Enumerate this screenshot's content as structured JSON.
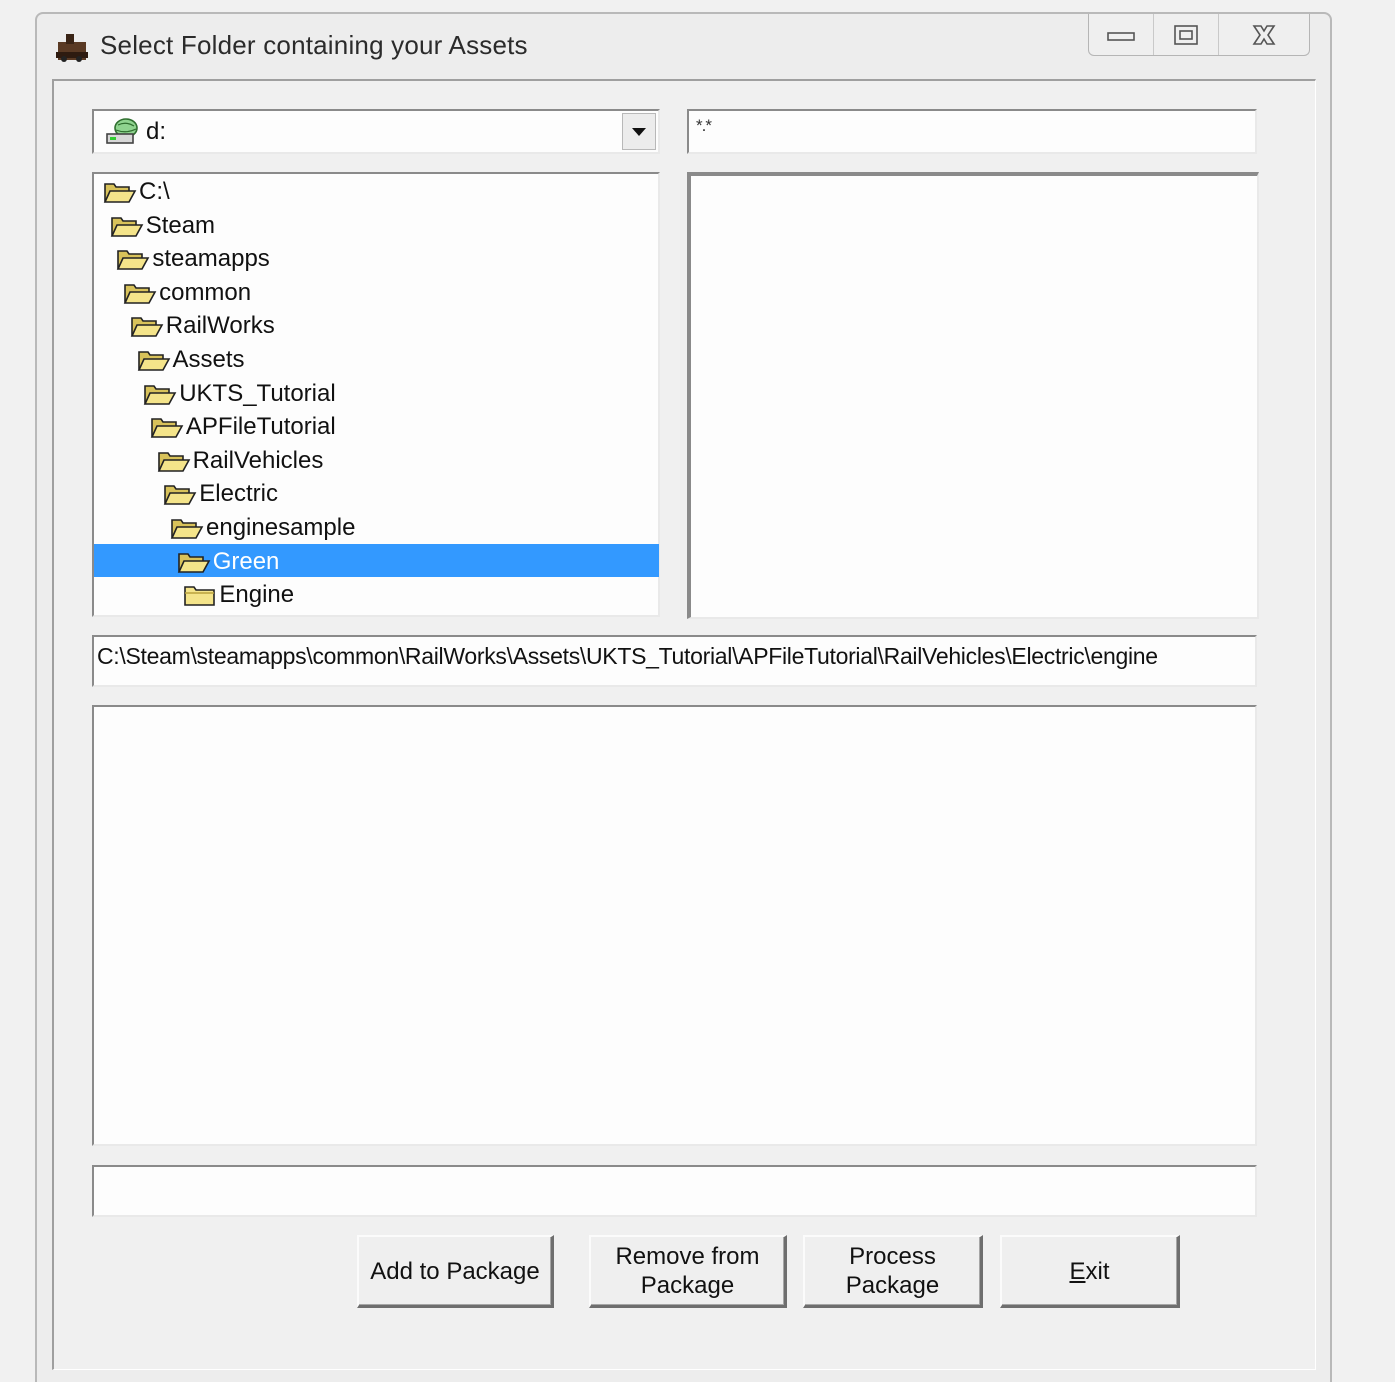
{
  "window": {
    "title": "Select Folder containing your Assets"
  },
  "drive": {
    "selected": "d:"
  },
  "filter": {
    "value": "*.*"
  },
  "folder_tree": {
    "items": [
      {
        "label": "C:\\",
        "selected": false
      },
      {
        "label": "Steam",
        "selected": false
      },
      {
        "label": "steamapps",
        "selected": false
      },
      {
        "label": "common",
        "selected": false
      },
      {
        "label": "RailWorks",
        "selected": false
      },
      {
        "label": "Assets",
        "selected": false
      },
      {
        "label": "UKTS_Tutorial",
        "selected": false
      },
      {
        "label": "APFileTutorial",
        "selected": false
      },
      {
        "label": "RailVehicles",
        "selected": false
      },
      {
        "label": "Electric",
        "selected": false
      },
      {
        "label": "enginesample",
        "selected": false
      },
      {
        "label": "Green",
        "selected": true
      },
      {
        "label": "Engine",
        "selected": false
      }
    ],
    "selection_color": "#3399ff"
  },
  "path": {
    "value": "C:\\Steam\\steamapps\\common\\RailWorks\\Assets\\UKTS_Tutorial\\APFileTutorial\\RailVehicles\\Electric\\engine"
  },
  "buttons": {
    "add_line1": "Add to Package",
    "remove_line1": "Remove from",
    "remove_line2": "Package",
    "process_line1": "Process",
    "process_line2": "Package",
    "exit_first": "E",
    "exit_rest": "xit"
  },
  "icons": {
    "title": "train-icon",
    "drive": "network-drive-icon",
    "folder_open": "open-folder-icon",
    "folder_closed": "folder-icon",
    "minimize": "minimize-icon",
    "maximize": "maximize-icon",
    "close": "close-icon"
  }
}
